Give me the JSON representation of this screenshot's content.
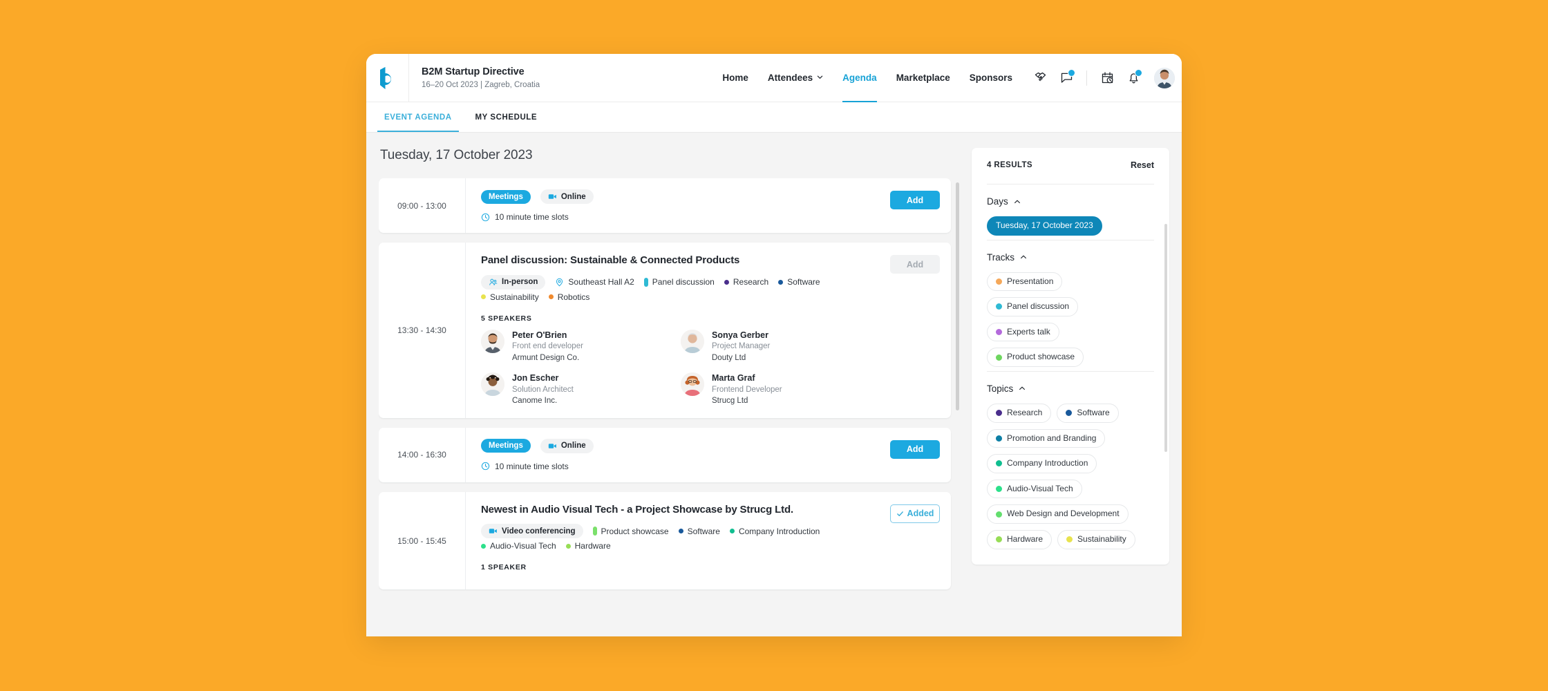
{
  "header": {
    "logo_icon": "b2match-logo-icon",
    "event_title": "B2M Startup Directive",
    "event_subtitle": "16–20 Oct 2023 | Zagreb, Croatia",
    "nav": [
      {
        "label": "Home",
        "active": false,
        "has_chevron": false
      },
      {
        "label": "Attendees",
        "active": false,
        "has_chevron": true
      },
      {
        "label": "Agenda",
        "active": true,
        "has_chevron": false
      },
      {
        "label": "Marketplace",
        "active": false,
        "has_chevron": false
      },
      {
        "label": "Sponsors",
        "active": false,
        "has_chevron": false
      }
    ],
    "icons": [
      {
        "name": "handshake-icon",
        "badge": false
      },
      {
        "name": "chat-message-icon",
        "badge": true
      },
      {
        "name": "calendar-clock-icon",
        "badge": false
      },
      {
        "name": "notification-bell-icon",
        "badge": true
      }
    ],
    "avatar_name": "user-avatar"
  },
  "subtabs": [
    {
      "label": "EVENT AGENDA",
      "active": true
    },
    {
      "label": "MY SCHEDULE",
      "active": false
    }
  ],
  "main": {
    "day_heading": "Tuesday, 17 October 2023",
    "cards": [
      {
        "time": "09:00 - 13:00",
        "type": "meetings",
        "pill_primary": "Meetings",
        "pill_secondary": "Online",
        "slot_text": "10 minute time slots",
        "action": {
          "label": "Add",
          "state": "add"
        }
      },
      {
        "time": "13:30 - 14:30",
        "type": "session",
        "title": "Panel discussion: Sustainable & Connected Products",
        "format_pill": "In-person",
        "location": "Southeast Hall A2",
        "tags": [
          {
            "label": "Panel discussion",
            "color": "#2FBAD4",
            "shape": "bar"
          },
          {
            "label": "Research",
            "color": "#4A2E8C",
            "shape": "dot"
          },
          {
            "label": "Software",
            "color": "#19599B",
            "shape": "dot"
          },
          {
            "label": "Sustainability",
            "color": "#E8E34E",
            "shape": "dot"
          },
          {
            "label": "Robotics",
            "color": "#F08A2E",
            "shape": "dot"
          }
        ],
        "speakers_label": "5 SPEAKERS",
        "speakers": [
          {
            "name": "Peter O'Brien",
            "role": "Front end developer",
            "org": "Armunt Design Co.",
            "avatar": "male-1"
          },
          {
            "name": "Sonya Gerber",
            "role": "Project Manager",
            "org": "Douty Ltd",
            "avatar": "female-1"
          },
          {
            "name": "Jon Escher",
            "role": "Solution Architect",
            "org": "Canome Inc.",
            "avatar": "male-2"
          },
          {
            "name": "Marta Graf",
            "role": "Frontend Developer",
            "org": "Strucg Ltd",
            "avatar": "female-2"
          }
        ],
        "action": {
          "label": "Add",
          "state": "disabled"
        }
      },
      {
        "time": "14:00 - 16:30",
        "type": "meetings",
        "pill_primary": "Meetings",
        "pill_secondary": "Online",
        "slot_text": "10 minute time slots",
        "action": {
          "label": "Add",
          "state": "add"
        }
      },
      {
        "time": "15:00 - 15:45",
        "type": "session",
        "title": "Newest in Audio Visual Tech - a Project Showcase by Strucg Ltd.",
        "format_pill": "Video conferencing",
        "tags": [
          {
            "label": "Product showcase",
            "color": "#7BE06B",
            "shape": "bar"
          },
          {
            "label": "Software",
            "color": "#19599B",
            "shape": "dot"
          },
          {
            "label": "Company Introduction",
            "color": "#10BE90",
            "shape": "dot"
          },
          {
            "label": "Audio-Visual Tech",
            "color": "#2CE08B",
            "shape": "dot"
          },
          {
            "label": "Hardware",
            "color": "#97DD56",
            "shape": "dot"
          }
        ],
        "speakers_label": "1 SPEAKER",
        "action": {
          "label": "Added",
          "state": "added"
        }
      }
    ]
  },
  "filters": {
    "results_count": "4 RESULTS",
    "reset_label": "Reset",
    "groups": [
      {
        "title": "Days",
        "collapse_icon": "caret-up-icon",
        "chips": [
          {
            "label": "Tuesday, 17 October 2023",
            "selected": true,
            "color": null
          }
        ]
      },
      {
        "title": "Tracks",
        "collapse_icon": "caret-up-icon",
        "chips": [
          {
            "label": "Presentation",
            "selected": false,
            "color": "#F5A85A"
          },
          {
            "label": "Panel discussion",
            "selected": false,
            "color": "#2FBAD4"
          },
          {
            "label": "Experts talk",
            "selected": false,
            "color": "#B46ADB"
          },
          {
            "label": "Product showcase",
            "selected": false,
            "color": "#6ED65F"
          }
        ]
      },
      {
        "title": "Topics",
        "collapse_icon": "caret-up-icon",
        "chips": [
          {
            "label": "Research",
            "selected": false,
            "color": "#4A2E8C"
          },
          {
            "label": "Software",
            "selected": false,
            "color": "#19599B"
          },
          {
            "label": "Promotion and Branding",
            "selected": false,
            "color": "#0D7FA5"
          },
          {
            "label": "Company Introduction",
            "selected": false,
            "color": "#10BE90"
          },
          {
            "label": "Audio-Visual Tech",
            "selected": false,
            "color": "#2CE08B"
          },
          {
            "label": "Web Design and Development",
            "selected": false,
            "color": "#63DE6E"
          },
          {
            "label": "Hardware",
            "selected": false,
            "color": "#97DD56"
          },
          {
            "label": "Sustainability",
            "selected": false,
            "color": "#E8E34E"
          }
        ]
      }
    ]
  },
  "theme": {
    "page_background": "#FBA928",
    "accent": "#1CA9E0",
    "accent_dark": "#0E87B8",
    "text": "#22272e"
  }
}
